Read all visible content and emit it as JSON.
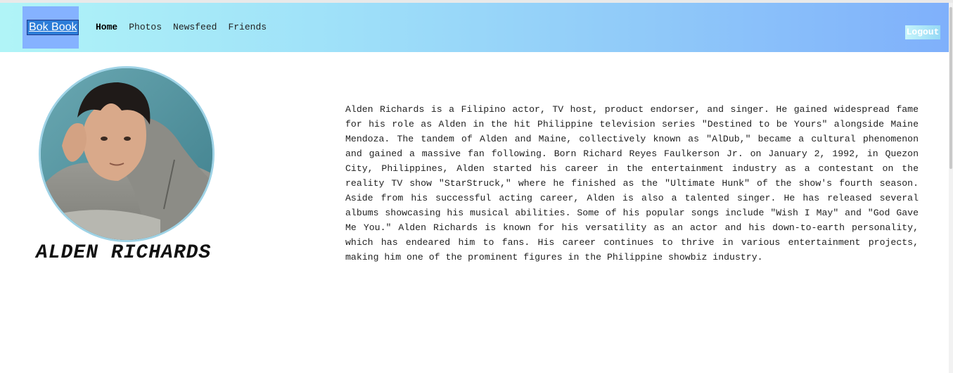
{
  "navbar": {
    "logo": "Bok Book",
    "links": [
      "Home",
      "Photos",
      "Newsfeed",
      "Friends"
    ],
    "active": "Home",
    "logout_label": "Logout"
  },
  "profile": {
    "name": "ALDEN RICHARDS",
    "bio": "Alden Richards is a Filipino actor, TV host, product endorser, and singer. He gained widespread fame for his role as Alden in the hit Philippine television series \"Destined to be Yours\" alongside Maine Mendoza. The tandem of Alden and Maine, collectively known as \"AlDub,\" became a cultural phenomenon and gained a massive fan following. Born Richard Reyes Faulkerson Jr. on January 2, 1992, in Quezon City, Philippines, Alden started his career in the entertainment industry as a contestant on the reality TV show \"StarStruck,\" where he finished as the \"Ultimate Hunk\" of the show's fourth season. Aside from his successful acting career, Alden is also a talented singer. He has released several albums showcasing his musical abilities. Some of his popular songs include \"Wish I May\" and \"God Gave Me You.\" Alden Richards is known for his versatility as an actor and his down-to-earth personality, which has endeared him to fans. His career continues to thrive in various entertainment projects, making him one of the prominent figures in the Philippine showbiz industry."
  },
  "colors": {
    "navbar_gradient_start": "#b0f4f7",
    "navbar_gradient_end": "#7fb0fb",
    "logo_bg": "#85b2ff",
    "logo_text_bg": "#2d7dd8",
    "avatar_border": "#9fd3e6"
  }
}
